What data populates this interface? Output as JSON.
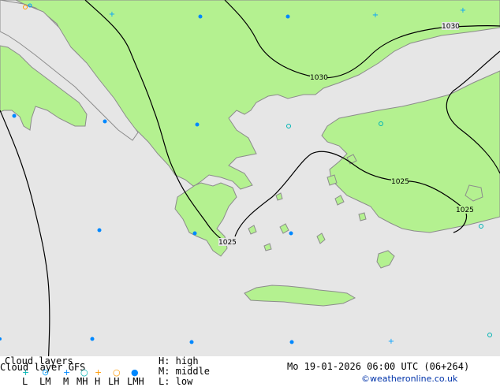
{
  "map": {
    "colors": {
      "sea": "#e6e6e6",
      "land": "#b4f190",
      "coast": "#8c8c8c",
      "isobar": "#000000",
      "high": "#00a0ff",
      "middle": "#0088ff",
      "low": "#00b4b4",
      "accent": "#ff9900"
    },
    "isobars": [
      {
        "label": "1030"
      },
      {
        "label": "1030"
      },
      {
        "label": "1025"
      },
      {
        "label": "1025"
      },
      {
        "label": "1025"
      }
    ],
    "markers": [
      {
        "type": "middle"
      },
      {
        "type": "middle"
      },
      {
        "type": "middle"
      },
      {
        "type": "middle"
      },
      {
        "type": "middle"
      },
      {
        "type": "middle"
      },
      {
        "type": "middle"
      },
      {
        "type": "middle"
      },
      {
        "type": "middle"
      },
      {
        "type": "middle"
      },
      {
        "type": "middle"
      },
      {
        "type": "middle"
      },
      {
        "type": "high"
      },
      {
        "type": "high"
      },
      {
        "type": "high"
      },
      {
        "type": "high"
      },
      {
        "type": "low"
      },
      {
        "type": "low"
      },
      {
        "type": "low"
      },
      {
        "type": "low"
      },
      {
        "type": "mixed"
      }
    ]
  },
  "legend": {
    "title": "Cloud layers",
    "model_line": "Cloud layer  GFS",
    "layers": [
      "L",
      "LM",
      "M",
      "MH",
      "H",
      "LH",
      "LMH"
    ],
    "key": [
      "H: high",
      "M: middle",
      "L: low"
    ]
  },
  "valid_time": "Mo 19-01-2026 06:00 UTC (06+264)",
  "credit": "©weatheronline.co.uk"
}
